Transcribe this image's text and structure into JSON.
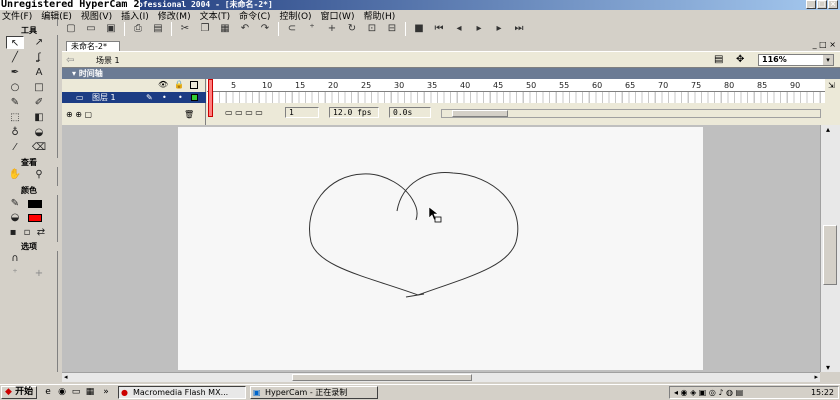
{
  "window": {
    "title_overlay": "Unregistered HyperCam 2",
    "title_rest": "ofessional 2004 - [未命名-2*]"
  },
  "menu": [
    "文件(F)",
    "编辑(E)",
    "视图(V)",
    "插入(I)",
    "修改(M)",
    "文本(T)",
    "命令(C)",
    "控制(O)",
    "窗口(W)",
    "帮助(H)"
  ],
  "tools": {
    "title": "工具",
    "view_label": "查看",
    "colors_label": "颜色",
    "options_label": "选项"
  },
  "document": {
    "tab_label": "未命名-2*",
    "scene_label": "场景 1",
    "zoom": "116%"
  },
  "timeline": {
    "header": "时间轴",
    "layer_name": "图层 1",
    "frame_ticks": [
      "1",
      "5",
      "10",
      "15",
      "20",
      "25",
      "30",
      "35",
      "40",
      "45",
      "50",
      "55",
      "60",
      "65",
      "70",
      "75",
      "80",
      "85",
      "90"
    ],
    "current_frame": "1",
    "fps": "12.0 fps",
    "elapsed": "0.0s"
  },
  "taskbar": {
    "start_label": "开始",
    "tasks": [
      {
        "label": "Macromedia Flash MX..."
      },
      {
        "label": "HyperCam - 正在录制"
      }
    ],
    "clock": "15:22"
  }
}
